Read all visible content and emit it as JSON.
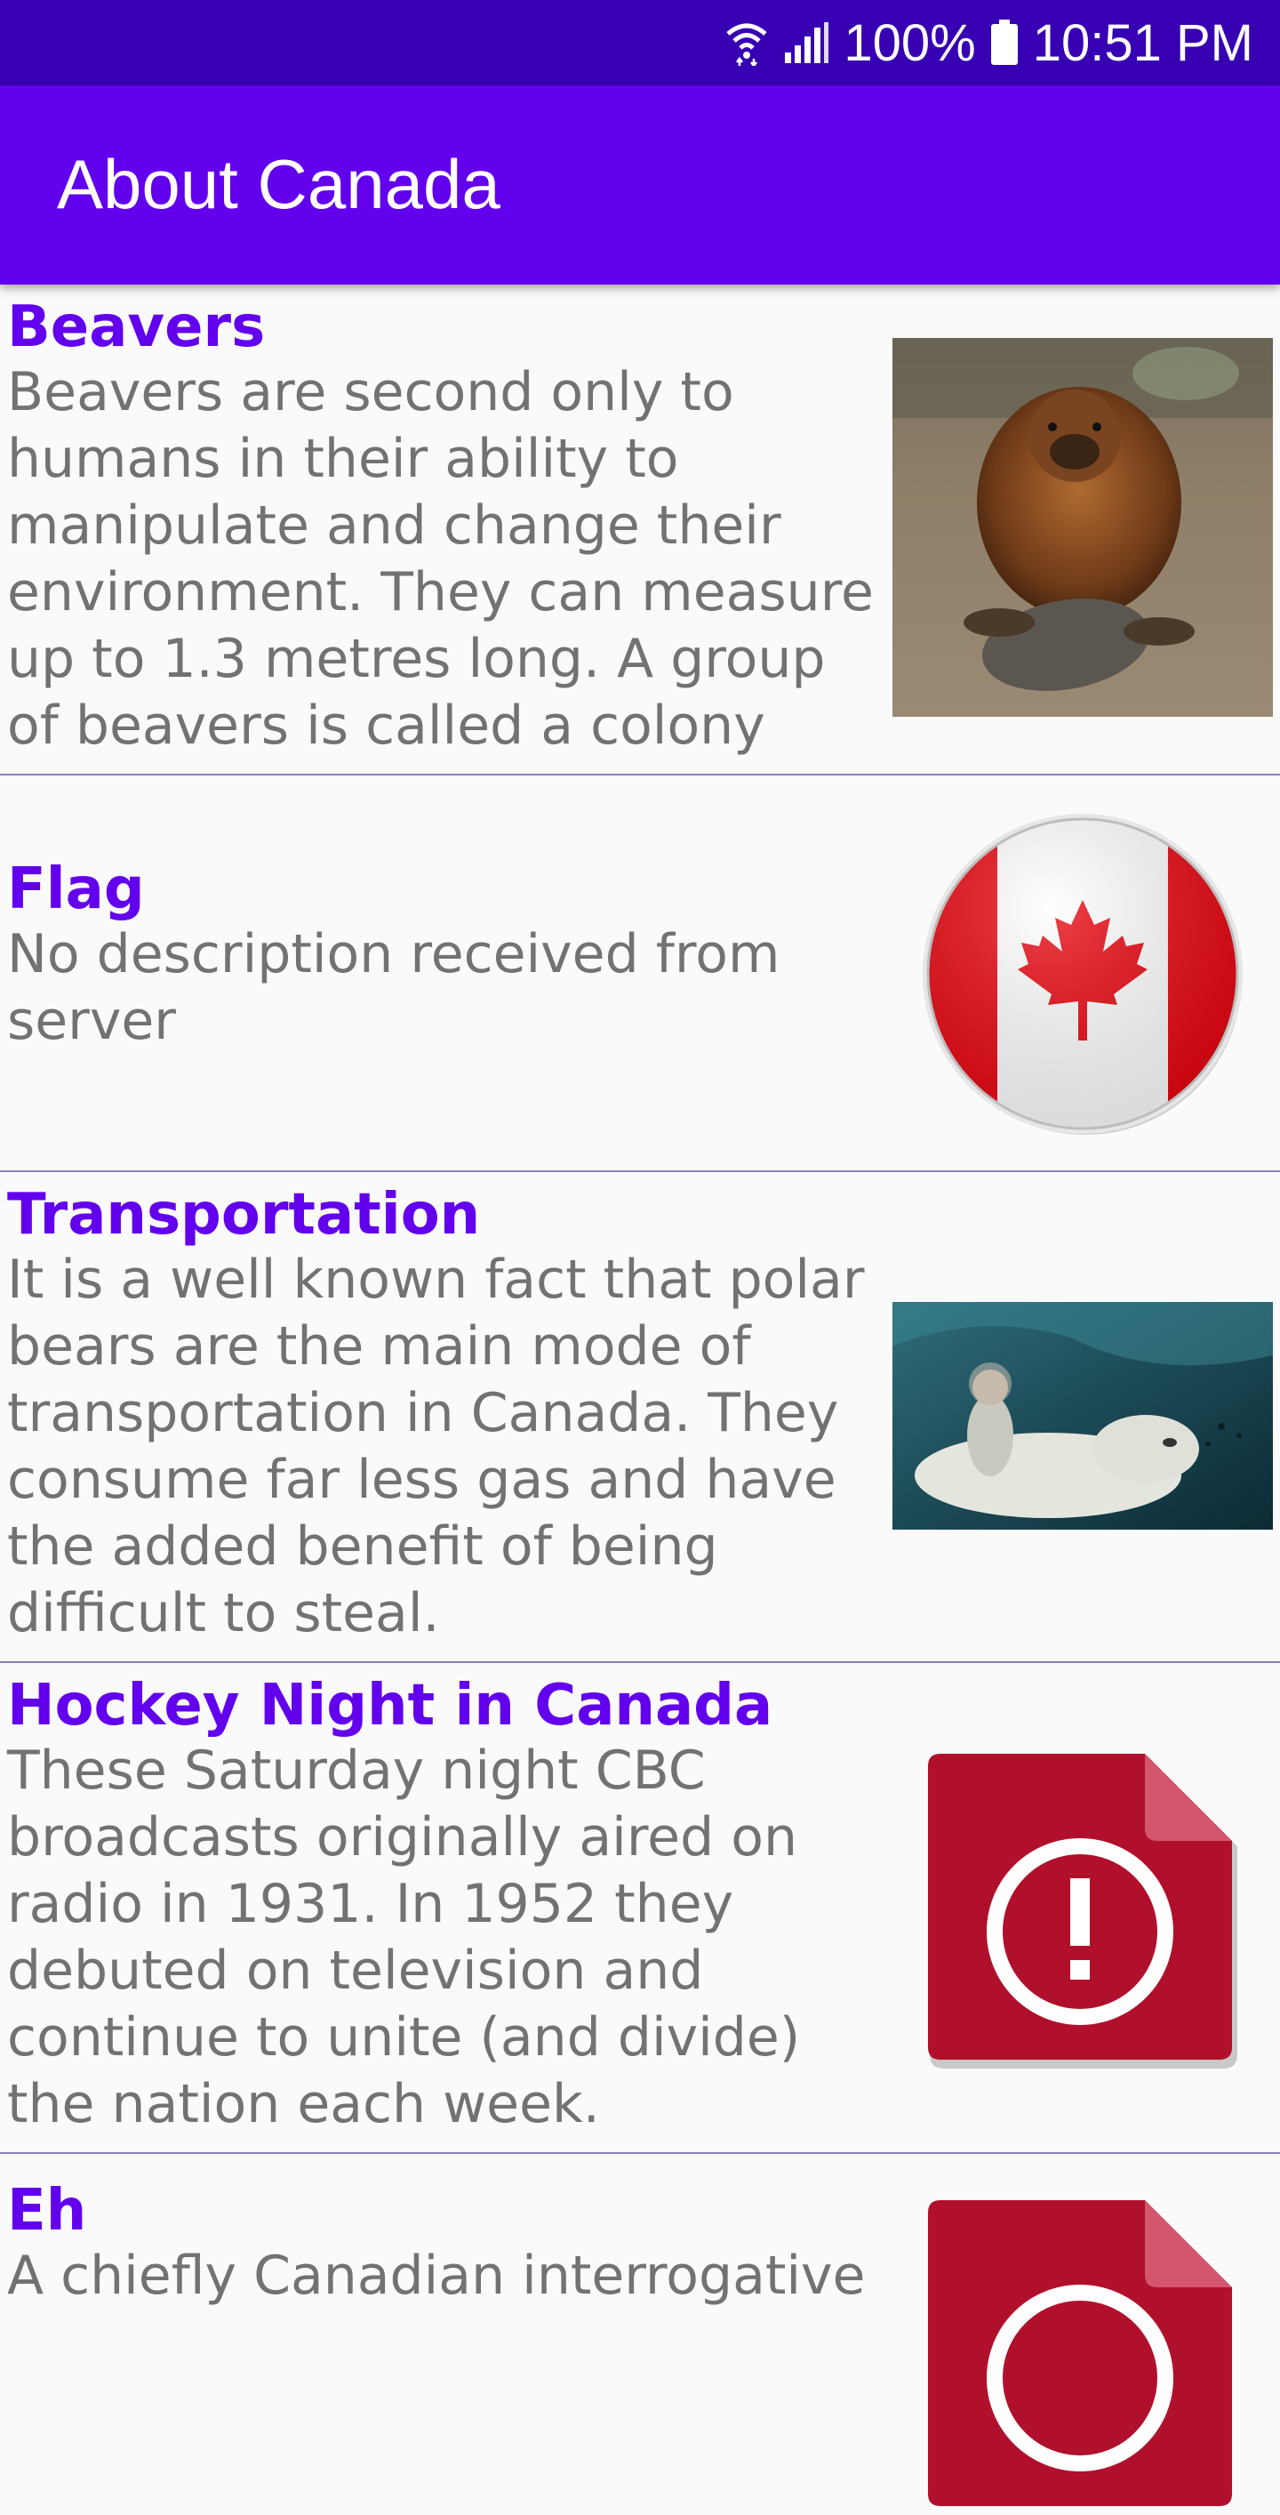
{
  "status_bar": {
    "battery": "100%",
    "time": "10:51 PM",
    "icons": [
      "wifi-icon",
      "signal-icon",
      "battery-icon"
    ]
  },
  "app_bar": {
    "title": "About Canada"
  },
  "colors": {
    "status_bar": "#3700b3",
    "app_bar": "#6200ee",
    "title_text": "#6200ee",
    "desc_text": "#727272",
    "divider": "#8e7cc3"
  },
  "rows": [
    {
      "title": "Beavers",
      "description": "Beavers are second only to humans in their ability to manipulate and change their environment. They can measure up to 1.3 metres long. A group of beavers is called a colony",
      "image": "beaver-photo"
    },
    {
      "title": "Flag",
      "description": "No description received from server",
      "image": "canada-flag-button"
    },
    {
      "title": "Transportation",
      "description": "It is a well known fact that polar bears are the main mode of transportation in Canada. They consume far less gas and have the added benefit of being difficult to steal.",
      "image": "polar-bear-rider-photo"
    },
    {
      "title": "Hockey Night in Canada",
      "description": "These Saturday night CBC broadcasts originally aired on radio in 1931. In 1952 they debuted on television and continue to unite (and divide) the nation each week.",
      "image": "broken-image-icon"
    },
    {
      "title": "Eh",
      "description": "A chiefly Canadian interrogative",
      "image": "broken-image-icon"
    }
  ]
}
